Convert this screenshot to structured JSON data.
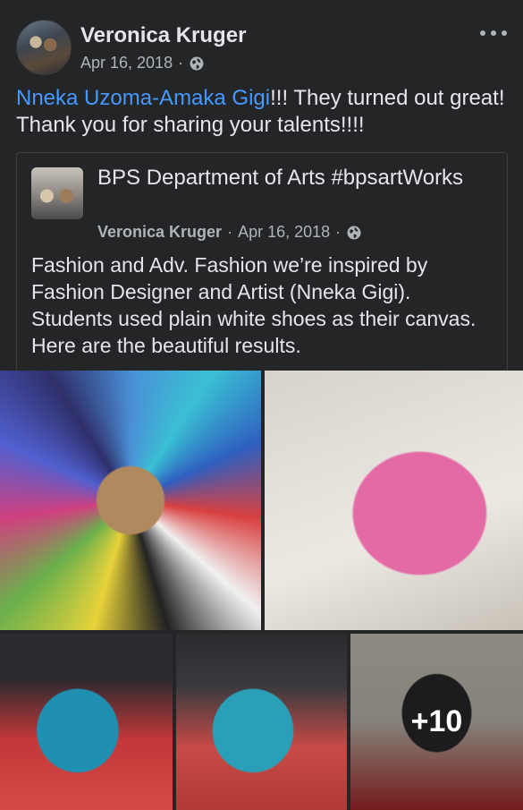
{
  "post": {
    "author": "Veronica Kruger",
    "date": "Apr 16, 2018",
    "privacy_icon": "globe-icon",
    "text_mention": "Nneka Uzoma-Amaka Gigi",
    "text_rest": "!!! They turned out great! Thank you for sharing your talents!!!!"
  },
  "shared": {
    "page_name": "BPS Department of Arts #bpsartWorks",
    "author": "Veronica Kruger",
    "separator": "·",
    "date": "Apr 16, 2018",
    "text": "Fashion and Adv. Fashion we’re inspired by Fashion Designer and Artist (Nneka Gigi). Students used plain white shoes as their canvas. Here are the beautiful results."
  },
  "photos": {
    "more_count": "+10"
  },
  "colors": {
    "background": "#242526",
    "text": "#e4e6eb",
    "secondary": "#b0b3b8",
    "mention": "#4599ff"
  }
}
